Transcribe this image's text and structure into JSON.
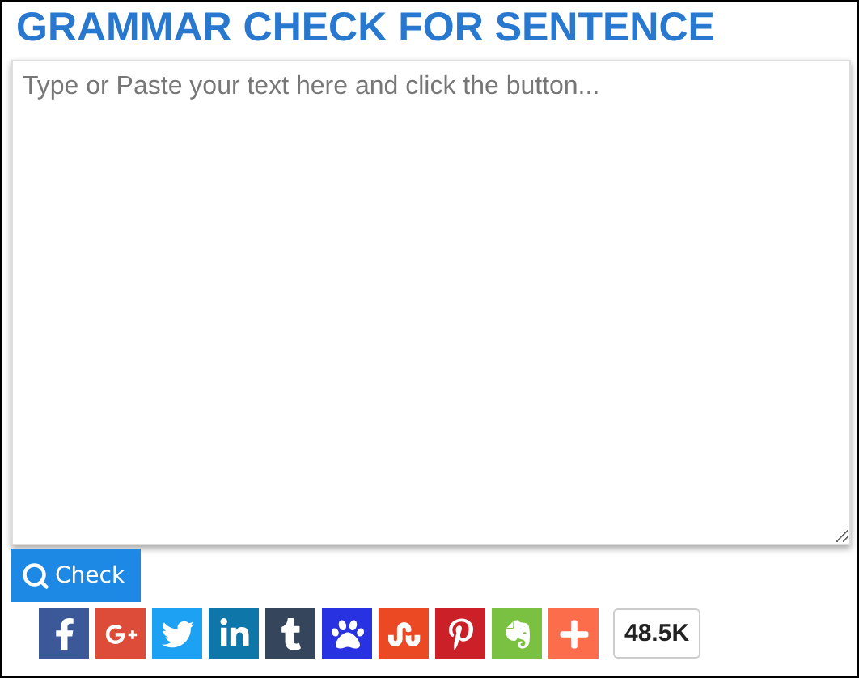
{
  "title": "GRAMMAR CHECK FOR SENTENCE",
  "editor": {
    "placeholder": "Type or Paste your text here and click the button..."
  },
  "check_button": {
    "label": "Check"
  },
  "share_buttons": [
    {
      "kind": "facebook",
      "color": "#3b5998"
    },
    {
      "kind": "googleplus",
      "color": "#dd4b39"
    },
    {
      "kind": "twitter",
      "color": "#1da1f2"
    },
    {
      "kind": "linkedin",
      "color": "#0e76a8"
    },
    {
      "kind": "tumblr",
      "color": "#35465c"
    },
    {
      "kind": "paw",
      "color": "#2932e1"
    },
    {
      "kind": "stumbleupon",
      "color": "#eb4924"
    },
    {
      "kind": "pinterest",
      "color": "#cb2027"
    },
    {
      "kind": "evernote",
      "color": "#7ac142"
    },
    {
      "kind": "more",
      "color": "#fc6d4c"
    }
  ],
  "share_count": "48.5K"
}
